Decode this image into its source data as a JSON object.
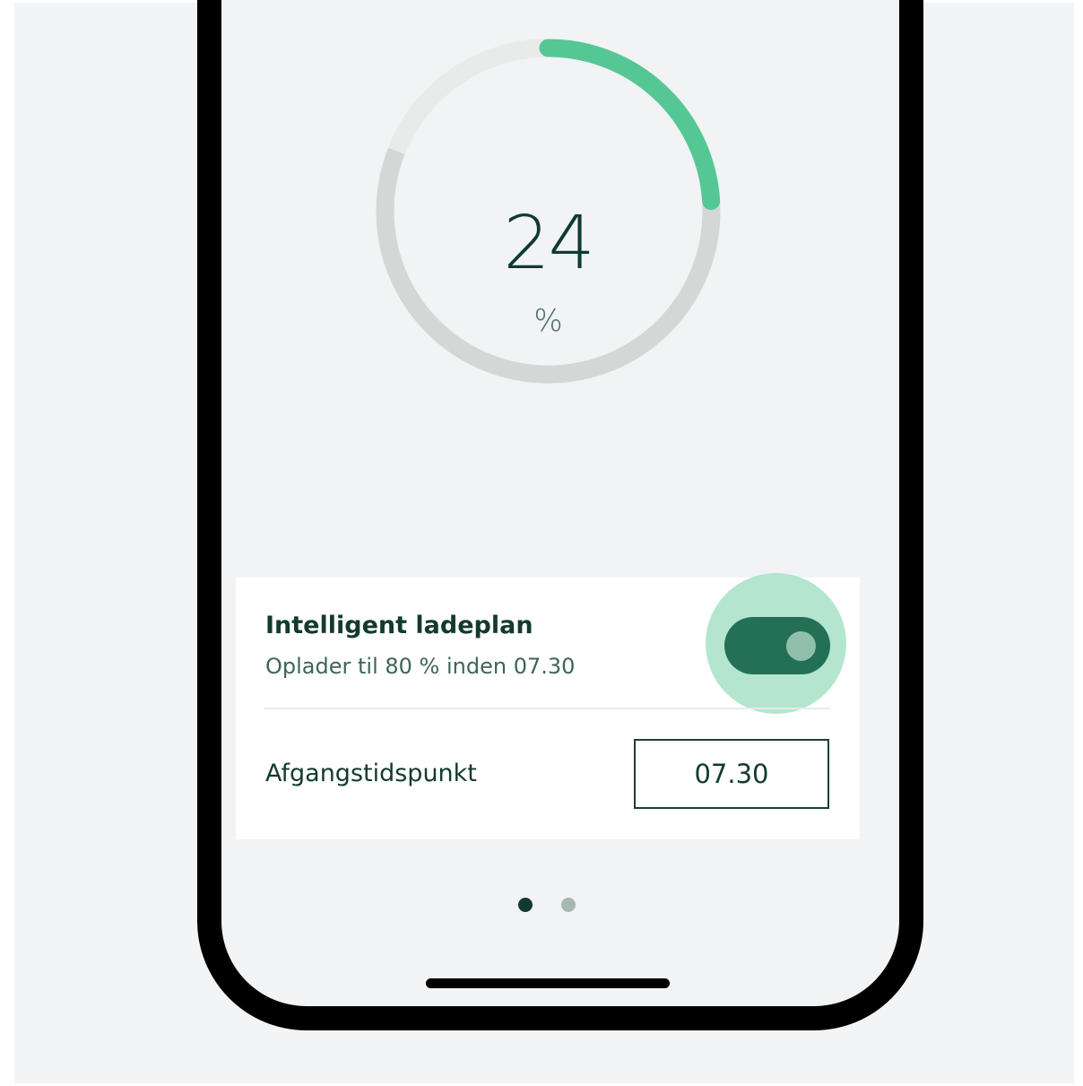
{
  "battery": {
    "percent_value": "24",
    "unit": "%",
    "fraction": 0.24,
    "colors": {
      "progress": "#55c795",
      "track": "#d3d8d6",
      "track_light": "#e9ebea"
    }
  },
  "charge_plan": {
    "title": "Intelligent ladeplan",
    "subtitle": "Oplader til 80 % inden 07.30",
    "toggle_on": true,
    "toggle_colors": {
      "track": "#237057",
      "knob": "#91bfab",
      "halo": "#b4e6cf"
    }
  },
  "departure": {
    "label": "Afgangstidspunkt",
    "time": "07.30"
  },
  "pager": {
    "total_pages": 2,
    "current_page": 1
  }
}
